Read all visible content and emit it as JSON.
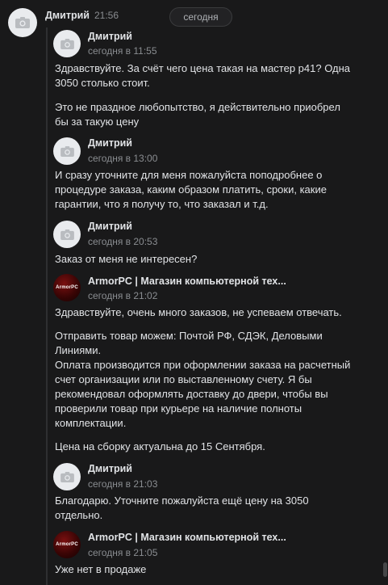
{
  "header": {
    "sender": "Дмитрий",
    "time": "21:56",
    "date_divider": "сегодня"
  },
  "brand": {
    "logo_text": "ArmorPC"
  },
  "messages": [
    {
      "author": "Дмитрий",
      "time": "сегодня в 11:55",
      "paragraphs": [
        "Здравствуйте. За счёт чего цена такая на мастер р41? Одна\n3050 столько стоит.",
        "Это не праздное любопытство, я действительно приобрел\nбы за такую цену"
      ]
    },
    {
      "author": "Дмитрий",
      "time": "сегодня в 13:00",
      "paragraphs": [
        "И сразу уточните для меня пожалуйста поподробнее о\nпроцедуре заказа, каким образом платить, сроки, какие\nгарантии, что я получу то, что заказал и т.д."
      ]
    },
    {
      "author": "Дмитрий",
      "time": "сегодня в 20:53",
      "paragraphs": [
        "Заказ от меня не интересен?"
      ]
    },
    {
      "author": "ArmorPC | Магазин компьютерной тех...",
      "time": "сегодня в 21:02",
      "paragraphs": [
        "Здравствуйте, очень много заказов, не успеваем отвечать.",
        "Отправить товар можем: Почтой РФ, СДЭК, Деловыми\nЛиниями.\nОплата производится при оформлении заказа на расчетный\nсчет организации или по выставленному счету. Я бы\nрекомендовал оформлять доставку до двери, чтобы вы\nпроверили товар при курьере на наличие полноты\nкомплектации.",
        "Цена на сборку актуальна до 15 Сентября."
      ]
    },
    {
      "author": "Дмитрий",
      "time": "сегодня в 21:03",
      "paragraphs": [
        "Благодарю. Уточните пожалуйста ещё цену на 3050\nотдельно."
      ]
    },
    {
      "author": "ArmorPC | Магазин компьютерной тех...",
      "time": "сегодня в 21:05",
      "paragraphs": [
        "Уже нет в продаже"
      ]
    }
  ]
}
